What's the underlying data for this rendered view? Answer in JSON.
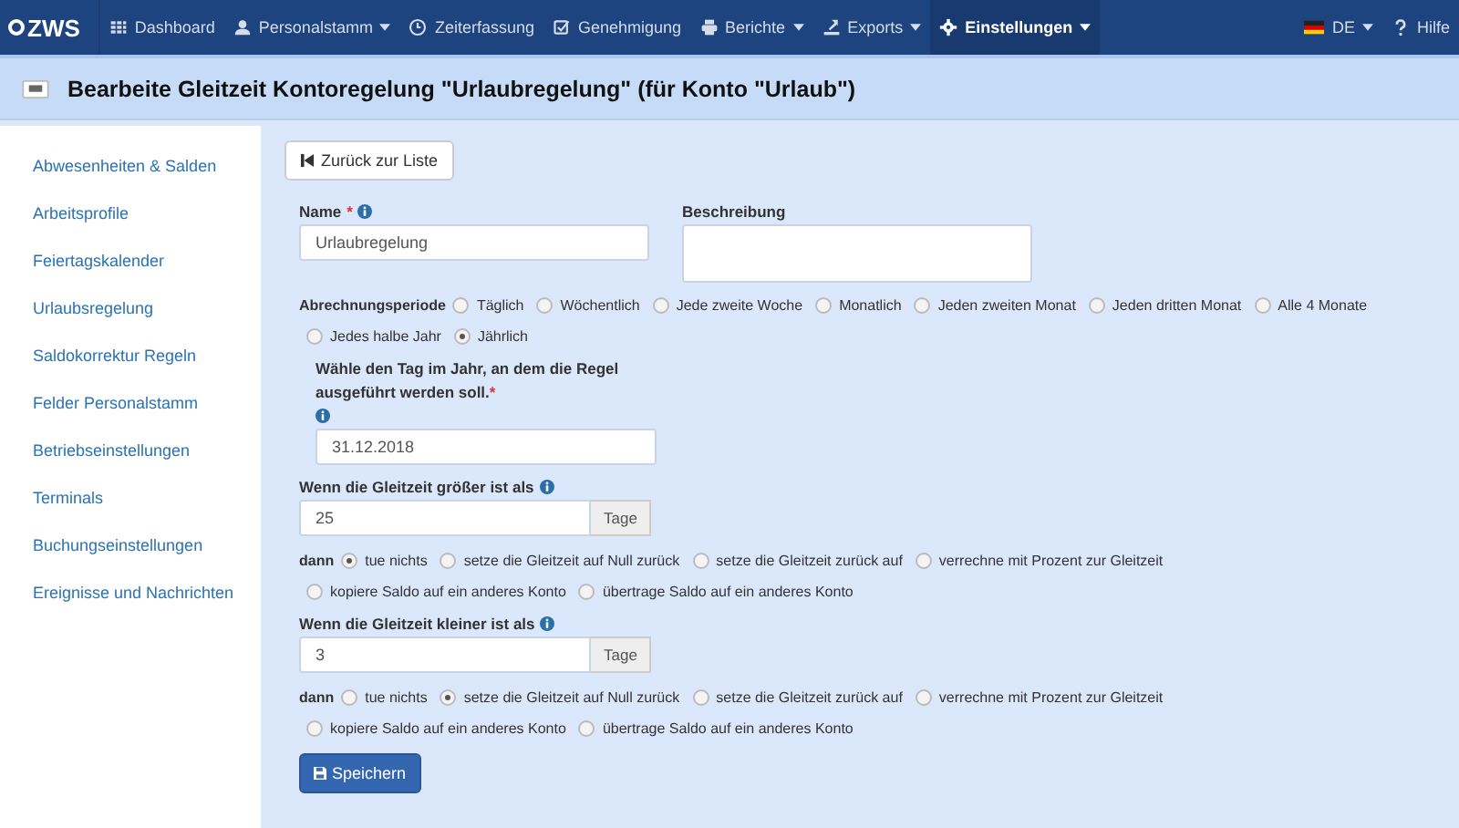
{
  "navbar": {
    "logo": "ZWS",
    "items": [
      {
        "label": "Dashboard",
        "dropdown": false,
        "selected": false
      },
      {
        "label": "Personalstamm",
        "dropdown": true,
        "selected": false
      },
      {
        "label": "Zeiterfassung",
        "dropdown": false,
        "selected": false
      },
      {
        "label": "Genehmigung",
        "dropdown": false,
        "selected": false
      },
      {
        "label": "Berichte",
        "dropdown": true,
        "selected": false
      },
      {
        "label": "Exports",
        "dropdown": true,
        "selected": false
      },
      {
        "label": "Einstellungen",
        "dropdown": true,
        "selected": true
      }
    ],
    "language": "DE",
    "help": "Hilfe"
  },
  "page_title": "Bearbeite Gleitzeit Kontoregelung \"Urlaubregelung\" (für Konto \"Urlaub\")",
  "sidebar": {
    "items": [
      {
        "label": "Abwesenheiten & Salden"
      },
      {
        "label": "Arbeitsprofile"
      },
      {
        "label": "Feiertagskalender"
      },
      {
        "label": "Urlaubsregelung"
      },
      {
        "label": "Saldokorrektur Regeln"
      },
      {
        "label": "Felder Personalstamm"
      },
      {
        "label": "Betriebseinstellungen"
      },
      {
        "label": "Terminals"
      },
      {
        "label": "Buchungseinstellungen"
      },
      {
        "label": "Ereignisse und Nachrichten"
      }
    ]
  },
  "back_button": "Zurück zur Liste",
  "name": {
    "label": "Name",
    "required_mark": "*",
    "value": "Urlaubregelung"
  },
  "description": {
    "label": "Beschreibung"
  },
  "period": {
    "label": "Abrechnungsperiode",
    "options": [
      {
        "label": "Täglich",
        "selected": false
      },
      {
        "label": "Wöchentlich",
        "selected": false
      },
      {
        "label": "Jede zweite Woche",
        "selected": false
      },
      {
        "label": "Monatlich",
        "selected": false
      },
      {
        "label": "Jeden zweiten Monat",
        "selected": false
      },
      {
        "label": "Jeden dritten Monat",
        "selected": false
      },
      {
        "label": "Alle 4 Monate",
        "selected": false
      },
      {
        "label": "Jedes halbe Jahr",
        "selected": false
      },
      {
        "label": "Jährlich",
        "selected": true
      }
    ]
  },
  "day": {
    "label": "Wähle den Tag im Jahr, an dem die Regel ausgeführt werden soll.",
    "required_mark": "*",
    "value": "31.12.2018"
  },
  "rules": [
    {
      "label": "Wenn die Gleitzeit größer ist als",
      "value": "25",
      "unit": "Tage",
      "then": "dann",
      "options": [
        {
          "label": "tue nichts",
          "selected": true
        },
        {
          "label": "setze die Gleitzeit auf Null zurück",
          "selected": false
        },
        {
          "label": "setze die Gleitzeit zurück auf",
          "selected": false
        },
        {
          "label": "verrechne mit Prozent zur Gleitzeit",
          "selected": false
        },
        {
          "label": "kopiere Saldo auf ein anderes Konto",
          "selected": false
        },
        {
          "label": "übertrage Saldo auf ein anderes Konto",
          "selected": false
        }
      ]
    },
    {
      "label": "Wenn die Gleitzeit kleiner ist als",
      "value": "3",
      "unit": "Tage",
      "then": "dann",
      "options": [
        {
          "label": "tue nichts",
          "selected": false
        },
        {
          "label": "setze die Gleitzeit auf Null zurück",
          "selected": true
        },
        {
          "label": "setze die Gleitzeit zurück auf",
          "selected": false
        },
        {
          "label": "verrechne mit Prozent zur Gleitzeit",
          "selected": false
        },
        {
          "label": "kopiere Saldo auf ein anderes Konto",
          "selected": false
        },
        {
          "label": "übertrage Saldo auf ein anderes Konto",
          "selected": false
        }
      ]
    }
  ],
  "save_button": "Speichern"
}
